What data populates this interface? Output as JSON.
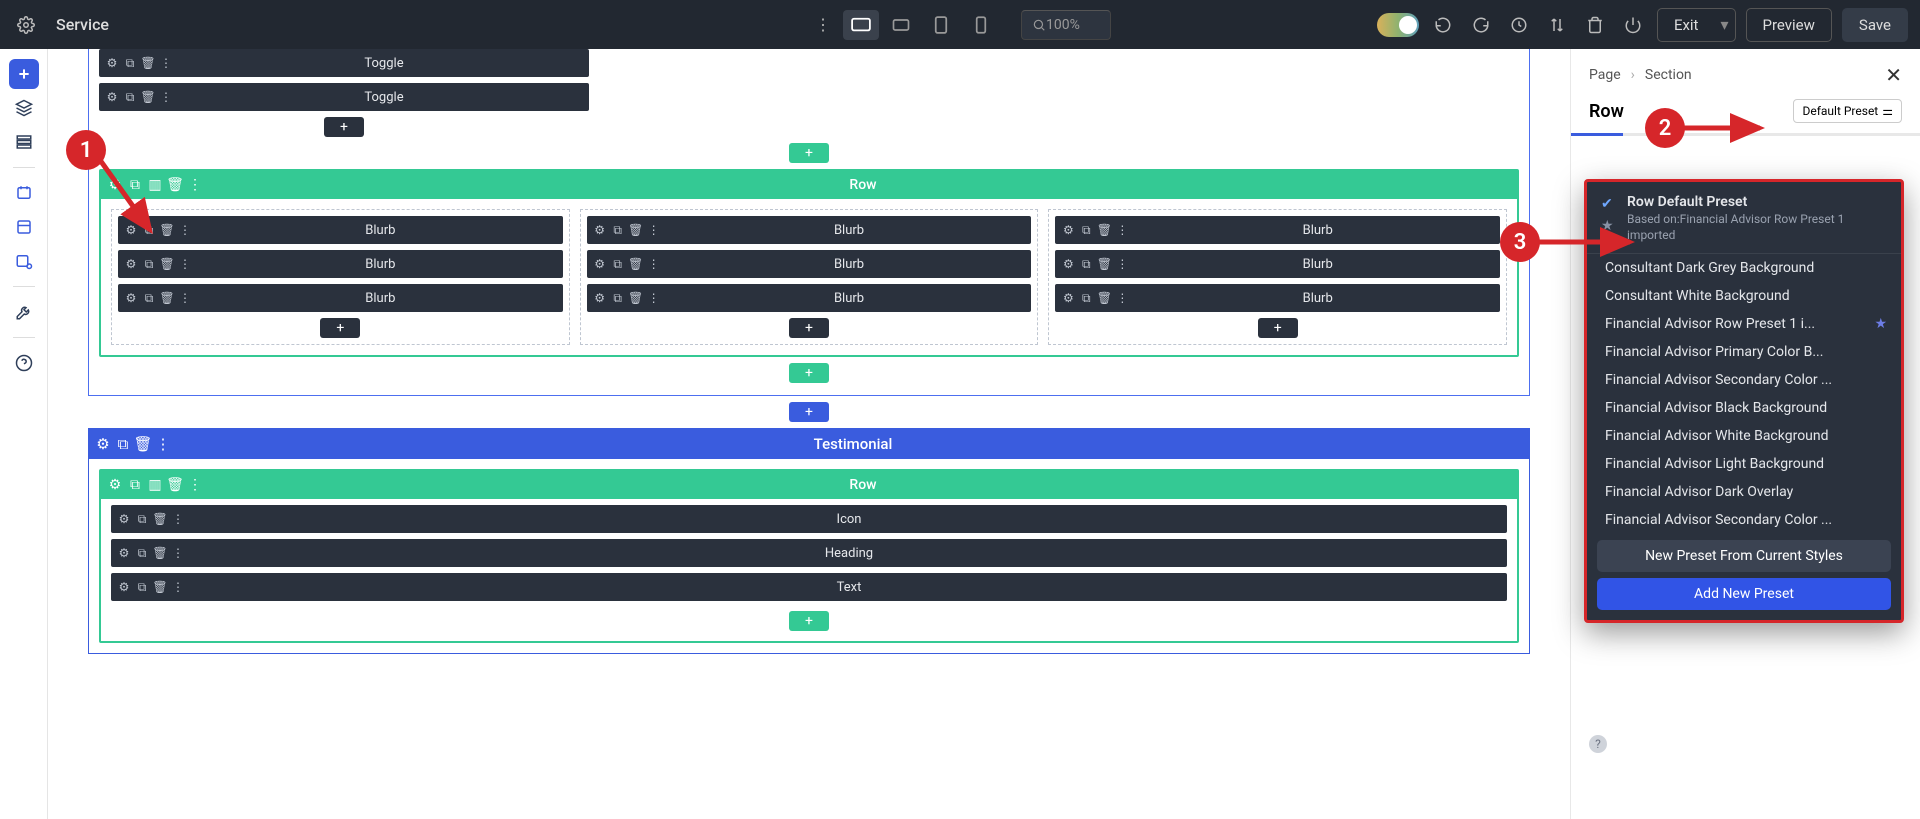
{
  "header": {
    "page_title": "Service",
    "zoom": "100%",
    "exit": "Exit",
    "preview": "Preview",
    "save": "Save"
  },
  "canvas": {
    "toggle_label": "Toggle",
    "row_label": "Row",
    "blurb_label": "Blurb",
    "testimonial_label": "Testimonial",
    "icon_label": "Icon",
    "heading_label": "Heading",
    "text_label": "Text"
  },
  "panel": {
    "breadcrumb_page": "Page",
    "breadcrumb_section": "Section",
    "entity": "Row",
    "preset_button": "Default Preset",
    "dropdown": {
      "head_title": "Row Default Preset",
      "head_sub": "Based on:Financial Advisor Row Preset 1 imported",
      "items": [
        "Consultant Dark Grey Background",
        "Consultant White Background",
        "Financial Advisor Row Preset 1 i...",
        "Financial Advisor Primary Color B...",
        "Financial Advisor Secondary Color ...",
        "Financial Advisor Black Background",
        "Financial Advisor White Background",
        "Financial Advisor Light Background",
        "Financial Advisor Dark Overlay",
        "Financial Advisor Secondary Color ..."
      ],
      "starred_index": 2,
      "new_from_current": "New Preset From Current Styles",
      "add_new": "Add New Preset"
    }
  },
  "annotations": {
    "n1": "1",
    "n2": "2",
    "n3": "3"
  }
}
